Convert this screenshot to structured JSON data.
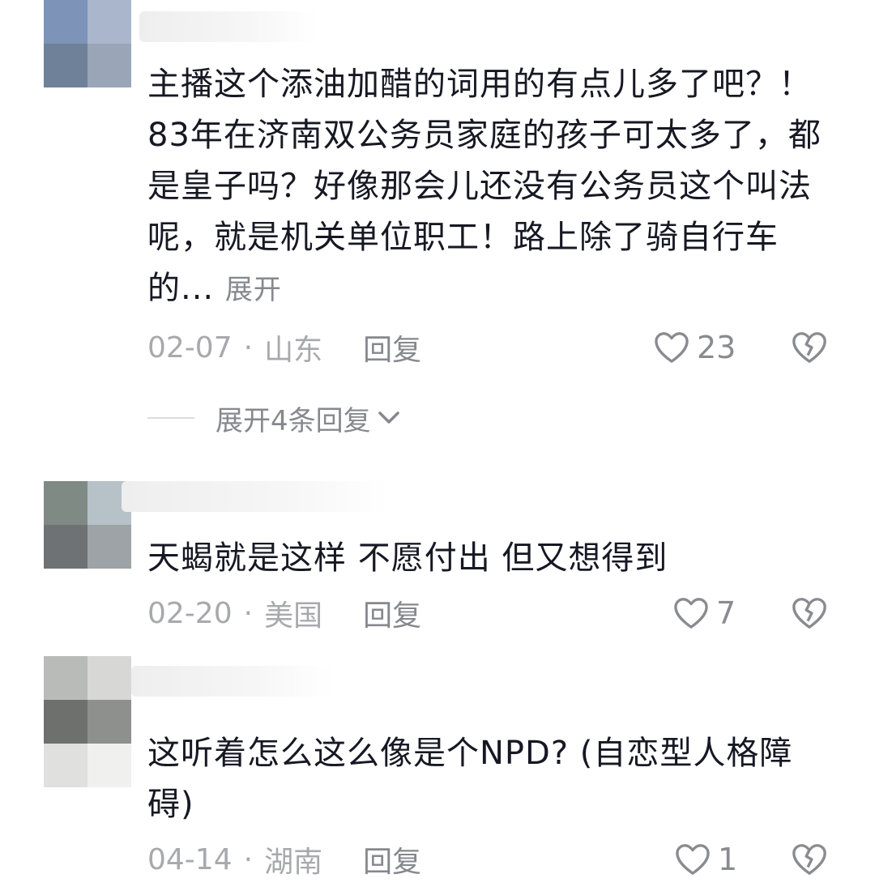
{
  "comments": [
    {
      "text": "主播这个添油加醋的词用的有点儿多了吧？！ 83年在济南双公务员家庭的孩子可太多了，都是皇子吗？好像那会儿还没有公务员这个叫法呢，就是机关单位职工！路上除了骑自行车的...",
      "expand_label": "展开",
      "date": "02-07",
      "region": "山东",
      "reply_label": "回复",
      "likes": "23",
      "more_replies_label": "展开4条回复"
    },
    {
      "text": "天蝎就是这样 不愿付出 但又想得到",
      "date": "02-20",
      "region": "美国",
      "reply_label": "回复",
      "likes": "7"
    },
    {
      "text": "这听着怎么这么像是个NPD? (自恋型人格障碍)",
      "date": "04-14",
      "region": "湖南",
      "reply_label": "回复",
      "likes": "1"
    }
  ],
  "icons": {
    "like": "heart-outline-icon",
    "dislike": "broken-heart-icon",
    "expand": "chevron-down-icon"
  },
  "colors": {
    "text": "#161823",
    "meta": "#a8a9ad",
    "secondary": "#86888e"
  }
}
